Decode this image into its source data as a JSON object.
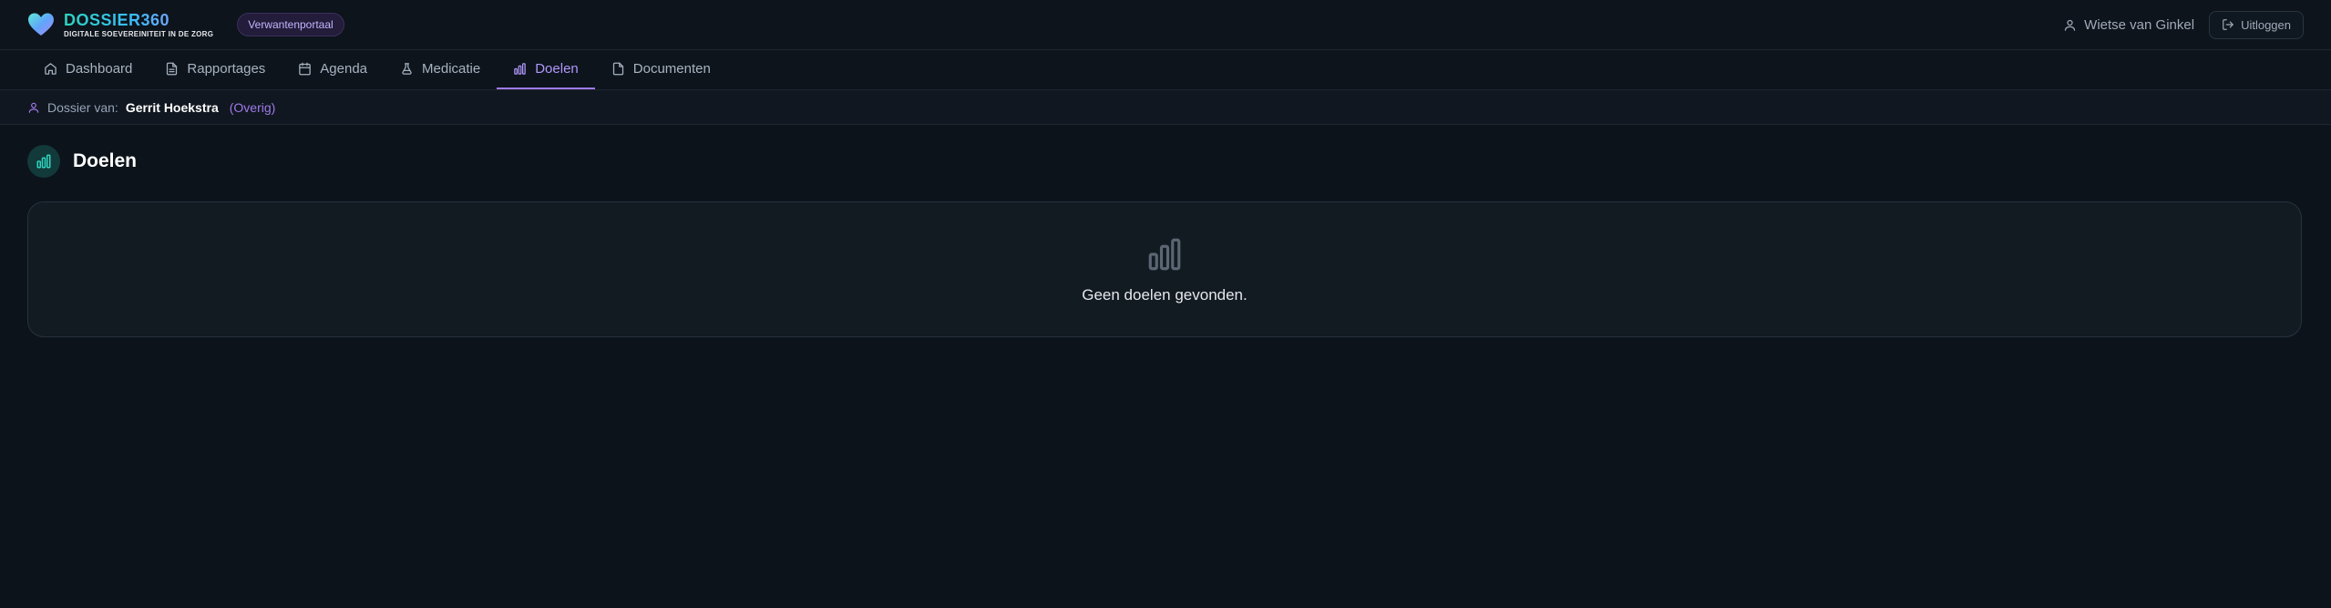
{
  "brand": {
    "name": "DOSSIER360",
    "subtitle": "DIGITALE SOEVEREINITEIT IN DE ZORG",
    "portal": "Verwantenportaal"
  },
  "user": {
    "name": "Wietse van Ginkel",
    "logout_label": "Uitloggen"
  },
  "nav": {
    "items": [
      {
        "label": "Dashboard",
        "icon": "home-icon"
      },
      {
        "label": "Rapportages",
        "icon": "document-lines-icon"
      },
      {
        "label": "Agenda",
        "icon": "calendar-icon"
      },
      {
        "label": "Medicatie",
        "icon": "flask-icon"
      },
      {
        "label": "Doelen",
        "icon": "bar-chart-icon",
        "active": true
      },
      {
        "label": "Documenten",
        "icon": "file-icon"
      }
    ]
  },
  "dossier": {
    "label": "Dossier van:",
    "name": "Gerrit Hoekstra",
    "relation": "(Overig)"
  },
  "page": {
    "title": "Doelen",
    "empty_message": "Geen doelen gevonden."
  },
  "colors": {
    "accent": "#9f7aea",
    "teal": "#2dd4bf",
    "background": "#0c131b"
  }
}
